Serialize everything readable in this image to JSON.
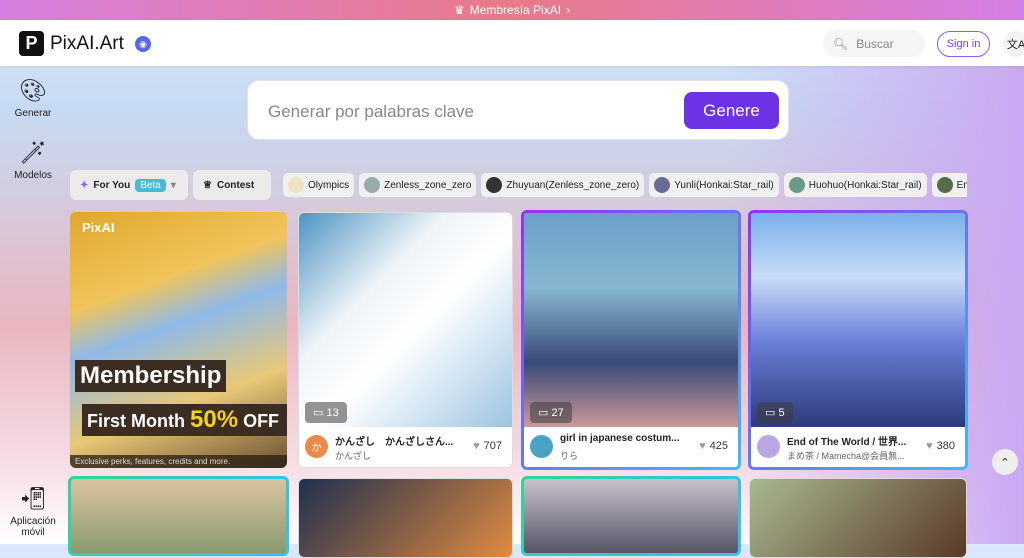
{
  "banner": {
    "label": "Membresía PixAI",
    "icon": "crown-icon"
  },
  "header": {
    "brand": "PixAI.Art",
    "logo_letter": "P",
    "search_placeholder": "Buscar",
    "signin": "Sign in",
    "lang_icon": "translate-icon"
  },
  "sidebar": {
    "items": [
      {
        "label": "Generar",
        "icon": "palette-icon"
      },
      {
        "label": "Modelos",
        "icon": "magic-wand-icon"
      },
      {
        "label": "Aplicación móvil",
        "icon": "phone-download-icon"
      }
    ]
  },
  "generate": {
    "placeholder": "Generar por palabras clave",
    "button": "Genere"
  },
  "filters": {
    "for_you": "For You",
    "beta": "Beta",
    "contest": "Contest"
  },
  "tags": [
    "Olympics",
    "Zenless_zone_zero",
    "Zhuyuan(Zenless_zone_zero)",
    "Yunli(Honkai:Star_rail)",
    "Huohuo(Honkai:Star_rail)",
    "Emilie(Genshin"
  ],
  "promo": {
    "brand": "PixAI",
    "title": "Membership",
    "line": "First Month",
    "discount": "50%",
    "off": "OFF",
    "note": "Exclusive perks, features, credits and more."
  },
  "cards": [
    {
      "comments": "13",
      "title": "かんざし　かんざしさん...",
      "author": "かんざし",
      "likes": "707",
      "avatar_letter": "か"
    },
    {
      "comments": "27",
      "title": "girl in japanese costum...",
      "author": "りら",
      "likes": "425"
    },
    {
      "comments": "5",
      "title": "End of The World / 世界...",
      "author": "まめ茶 / Mamecha@会員無...",
      "likes": "380"
    }
  ],
  "colors": {
    "accent": "#6d32e6",
    "beta": "#49b8d9"
  }
}
